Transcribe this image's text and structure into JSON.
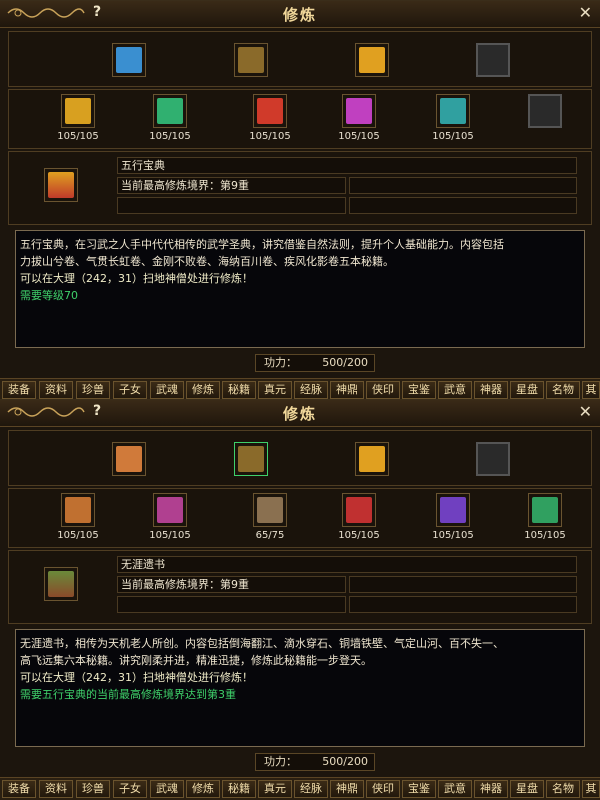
{
  "colors": {
    "panel_bg": "#1c150d",
    "title_color": "#f0d79a",
    "green_text": "#3fd06a"
  },
  "tabs": [
    "装备",
    "资料",
    "珍兽",
    "子女",
    "武魂",
    "修炼",
    "秘籍",
    "真元",
    "经脉",
    "神鼎",
    "侠印",
    "宝鉴",
    "武意",
    "神器",
    "星盘",
    "名物",
    "其"
  ],
  "panels": [
    {
      "title": "修炼",
      "help_icon": "?",
      "close_icon": "✕",
      "top_row": [
        {
          "icon": "book-blue-icon",
          "color": "#3a8fd0"
        },
        {
          "icon": "scroll-bundle-icon",
          "color": "#8a6a2a"
        },
        {
          "icon": "treasure-gold-icon",
          "color": "#e0a020"
        },
        {
          "icon": "empty-slot",
          "color": ""
        }
      ],
      "second_row": [
        {
          "icon": "book-yellow-icon",
          "color": "#d8a020",
          "count": "105/105"
        },
        {
          "icon": "book-green-icon",
          "color": "#30b070",
          "count": "105/105"
        },
        {
          "icon": "book-red-icon",
          "color": "#d03a2a",
          "count": "105/105"
        },
        {
          "icon": "book-purple-icon",
          "color": "#c040c0",
          "count": "105/105"
        },
        {
          "icon": "book-teal-icon",
          "color": "#30a0a0",
          "count": "105/105"
        },
        {
          "icon": "empty-slot",
          "color": "",
          "count": ""
        }
      ],
      "selected_icon": "book-stack-icon",
      "book_name": "五行宝典",
      "realm_text": "当前最高修炼境界：第9重",
      "description": [
        "五行宝典，在习武之人手中代代相传的武学圣典，讲究借鉴自然法则，提升个人基础能力。内容包括",
        "力拔山兮卷、气贯长虹卷、金刚不败卷、海纳百川卷、疾风化影卷五本秘籍。",
        "可以在大理（242，31）扫地神僧处进行修炼！"
      ],
      "requirement": "需要等级70",
      "power_label": "功力：",
      "power_value": "500/200"
    },
    {
      "title": "修炼",
      "help_icon": "?",
      "close_icon": "✕",
      "top_row": [
        {
          "icon": "book-blue-icon",
          "color": "#d07a3a"
        },
        {
          "icon": "scroll-bundle-icon",
          "color": "#8a6a2a"
        },
        {
          "icon": "treasure-gold-icon",
          "color": "#e0a020"
        },
        {
          "icon": "empty-slot",
          "color": ""
        }
      ],
      "second_row": [
        {
          "icon": "scroll-orange-icon",
          "color": "#c07030",
          "count": "105/105"
        },
        {
          "icon": "scroll-pink-icon",
          "color": "#b04090",
          "count": "105/105"
        },
        {
          "icon": "scroll-brown-icon",
          "color": "#8a7050",
          "count": "65/75"
        },
        {
          "icon": "scroll-red-icon",
          "color": "#c03030",
          "count": "105/105"
        },
        {
          "icon": "scroll-violet-icon",
          "color": "#7040c0",
          "count": "105/105"
        },
        {
          "icon": "scroll-green-icon",
          "color": "#30a060",
          "count": "105/105"
        }
      ],
      "selected_icon": "scroll-bundle-icon",
      "book_name": "无涯遗书",
      "realm_text": "当前最高修炼境界：第9重",
      "description": [
        "无涯遗书，相传为天机老人所创。内容包括倒海翻江、滴水穿石、铜墙铁壁、气定山河、百不失一、",
        "高飞远集六本秘籍。讲究刚柔并进，精准迅捷，修炼此秘籍能一步登天。",
        "可以在大理（242，31）扫地神僧处进行修炼！"
      ],
      "requirement": "需要五行宝典的当前最高修炼境界达到第3重",
      "power_label": "功力：",
      "power_value": "500/200"
    }
  ]
}
